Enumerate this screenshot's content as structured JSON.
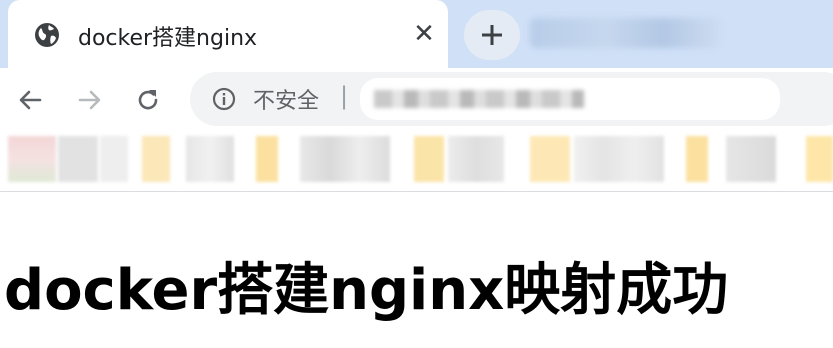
{
  "tab": {
    "title": "docker搭建nginx",
    "icon": "globe-icon",
    "close_glyph": "✕",
    "new_tab_glyph": "+"
  },
  "toolbar": {
    "security_label": "不安全",
    "separator": "|"
  },
  "page": {
    "heading": "docker搭建nginx映射成功"
  },
  "colors": {
    "tabstrip_bg": "#cfe0f7",
    "omnibox_bg": "#f1f3f4",
    "icon_color": "#5f6368"
  }
}
